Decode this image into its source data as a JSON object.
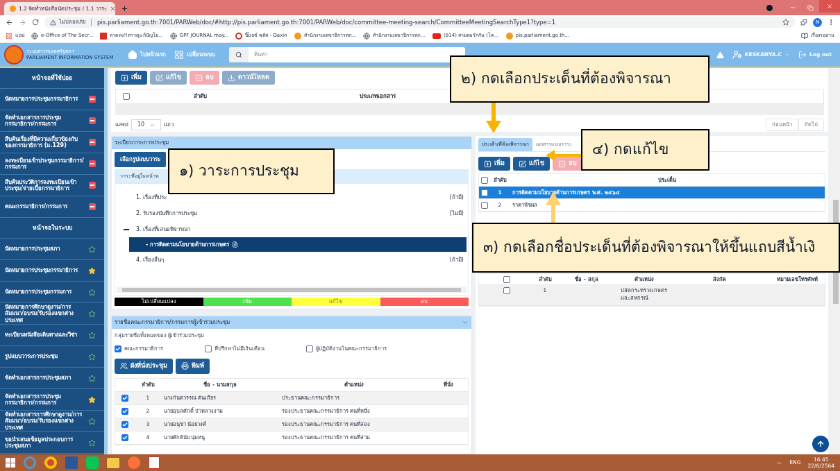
{
  "browser": {
    "tab_title": "1.2 จัดทำหนังสือนัดประชุม / 1.1 วาระ",
    "security_label": "ไม่ปลอดภัย",
    "url": "pis.parliament.go.th:7001/PARWeb/doc/#http://pis.parliament.go.th:7001/PARWeb/doc/committee-meeting-search/CommitteeMeetingSearchType1?type=1",
    "profile_initial": "N",
    "reading_list": "เรื่องรออ่าน",
    "bookmarks": [
      "แอป",
      "e-Office of The Secr...",
      "ลาดลง!!สาวดูแก้ปัญโย...",
      "GPF JOURNAL may...",
      "บิ๊มอซ์ พลัส - Daxin",
      "สำนักงานเลขาธิการสภ...",
      "สำนักงานเลขาธิการสภ...",
      "(814) สายลมรักกัน (โค...",
      "pis.parliament.go.th..."
    ]
  },
  "header": {
    "org_name": "ระบบสารสนเทศรัฐสภา",
    "org_subtitle": "PARLIAMENT INFORMATION SYSTEM",
    "home": "ไปหน้าแรก",
    "switch": "เปลี่ยนระบบ",
    "search_placeholder": "ค้นหา",
    "user": "KESKANYA.C",
    "logout": "Log out"
  },
  "sidebar": {
    "sections": [
      {
        "title": "หน้าจอที่ใช้บ่อย",
        "items": [
          {
            "label": "นัดหมายการประชุมกรรมาธิการ",
            "kind": "remove"
          },
          {
            "label": "จัดทำเอกสารการประชุมกรรมาธิการ/กรรมการ",
            "kind": "remove"
          },
          {
            "label": "สืบค้นเรื่องที่มีความเกี่ยวข้องกับของกรรมาธิการ (ม.129)",
            "kind": "remove"
          },
          {
            "label": "ลงทะเบียนเข้าประชุมกรรมาธิการ/กรรมการ",
            "kind": "remove"
          },
          {
            "label": "สืบค้นประวัติการลงทะเบียนเข้าประชุม/จ่ายเบี้ยกรรมาธิการ",
            "kind": "remove"
          },
          {
            "label": "คณะกรรมาธิการ/กรรมการ",
            "kind": "remove"
          }
        ]
      },
      {
        "title": "หน้าจอในระบบ",
        "items": [
          {
            "label": "นัดหมายการประชุมสภา",
            "kind": "favorite",
            "starred": false
          },
          {
            "label": "นัดหมายการประชุมกรรมาธิการ",
            "kind": "favorite",
            "starred": true
          },
          {
            "label": "นัดหมายการประชุมกรรมการ",
            "kind": "favorite",
            "starred": false
          },
          {
            "label": "นัดหมายการศึกษาดูงาน/การสัมมนา/อบรม/รับรองแขกต่างประเทศ",
            "kind": "favorite",
            "starred": false
          },
          {
            "label": "ทะเบียนหนังสือเดินทางและวีซ่า",
            "kind": "favorite",
            "starred": false
          },
          {
            "label": "รูปแบบวาระการประชุม",
            "kind": "favorite",
            "starred": false
          },
          {
            "label": "จัดทำเอกสารการประชุมสภา",
            "kind": "favorite",
            "starred": false
          },
          {
            "label": "จัดทำเอกสารการประชุมกรรมาธิการ/กรรมการ",
            "kind": "favorite",
            "starred": true
          },
          {
            "label": "จัดทำเอกสารการศึกษาดูงาน/การสัมมนา/อบรม/รับรองแขกต่างประเทศ",
            "kind": "favorite",
            "starred": false
          },
          {
            "label": "ขอนำเสนอข้อมูลประกอบการประชุมสภา",
            "kind": "favorite",
            "starred": false
          }
        ]
      }
    ]
  },
  "documents": {
    "buttons": [
      {
        "label": "เพิ่ม",
        "kind": "add",
        "disabled": false
      },
      {
        "label": "แก้ไข",
        "kind": "edit",
        "disabled": true
      },
      {
        "label": "ลบ",
        "kind": "delete",
        "disabled": true
      },
      {
        "label": "ดาวน์โหลด",
        "kind": "download",
        "disabled": true
      }
    ],
    "all_checked": false,
    "columns": [
      "ลำดับ",
      "ประเภทเอกสาร"
    ],
    "show_label": "แสดง",
    "page_size": "10",
    "rows_label": "แถว",
    "pager": [
      "ก่อนหน้า",
      "ถัดไป"
    ]
  },
  "agenda": {
    "title": "ระเบียบวาระการประชุม",
    "format_button": "เลือกรูปแบบวาระ",
    "tab": "วาระที่อยู่ในหน้าห",
    "items": [
      {
        "label": "1. เรื่องที่ประ",
        "note": "(ถ้ามี)"
      },
      {
        "label": "2. รับรองบันทึกการประชุม",
        "note": "(ไม่มี)"
      },
      {
        "label": "3. เรื่องที่เสนอพิจารณา",
        "expanded": true,
        "children": [
          {
            "label": "- การติดตามนโยบายด้านการเกษตร",
            "selected": true
          }
        ]
      },
      {
        "label": "4. เรื่องอื่นๆ",
        "note": "(ถ้ามี)"
      }
    ],
    "legend": [
      {
        "label": "ไม่เปลี่ยนแปลง",
        "color": "#000000"
      },
      {
        "label": "เพิ่ม",
        "color": "#4ee34e"
      },
      {
        "label": "แก้ไข",
        "color": "#ffff3c"
      },
      {
        "label": "ลบ",
        "color": "#ff5a5a"
      }
    ]
  },
  "attendees": {
    "title": "รายชื่อคณะกรรมาธิการ/กรรมการผู้เข้าร่วมประชุม",
    "subtitle": "กลุ่มรายชื่อทั้งหมดของ ผู้เข้าร่วมประชุม",
    "groups": [
      {
        "label": "คณะกรรมาธิการ",
        "checked": true
      },
      {
        "label": "ที่ปรึกษาไม่มีเงินเดือน",
        "checked": false
      },
      {
        "label": "ผู้ปฏิบัติงานในคณะกรรมาธิการ",
        "checked": false
      }
    ],
    "buttons": [
      {
        "label": "ผังที่นั่งประชุม",
        "kind": "seating"
      },
      {
        "label": "พิมพ์",
        "kind": "print"
      }
    ],
    "columns": [
      "ลำดับ",
      "ชื่อ - นามสกุล",
      "ตำแหน่ง",
      "ที่นั่ง"
    ],
    "rows": [
      {
        "number": "1",
        "name": "นางกันตวรรณ ตันเถียร",
        "position": "ประธานคณะกรรมาธิการ",
        "checked": true
      },
      {
        "number": "2",
        "name": "นายอุบลศักดิ์ บัวหลวงงาม",
        "position": "รองประธานคณะกรรมาธิการ คนที่หนึ่ง",
        "checked": true
      },
      {
        "number": "3",
        "name": "นายอนุชา น้อยวงศ์",
        "position": "รองประธานคณะกรรมาธิการ คนที่สอง",
        "checked": true
      },
      {
        "number": "4",
        "name": "นายศักดินัย นุ่มหนู",
        "position": "รองประธานคณะกรรมาธิการ คนที่สาม",
        "checked": true
      }
    ]
  },
  "issues": {
    "tabs": [
      {
        "label": "ประเด็นที่ต้องพิจารณา",
        "selected": true
      },
      {
        "label": "เอกสารแนบวาระ",
        "selected": false
      }
    ],
    "buttons": [
      {
        "label": "เพิ่ม",
        "kind": "add",
        "disabled": false
      },
      {
        "label": "แก้ไข",
        "kind": "edit",
        "disabled": false
      },
      {
        "label": "ลบ",
        "kind": "delete",
        "disabled": true
      }
    ],
    "all_checked": false,
    "columns": [
      "ลำดับ",
      "ประเด็น"
    ],
    "rows": [
      {
        "number": "1",
        "title": "การติดตามนโยบายด้านการเกษตร พ.ศ. ๒๕๖๔",
        "selected": true,
        "checked": false
      },
      {
        "number": "2",
        "title": "ราคาพืชผล",
        "selected": false,
        "checked": false
      }
    ],
    "participants_all_checked": false,
    "participant_columns": [
      "ลำดับ",
      "ชื่อ - สกุล",
      "ตำแหน่ง",
      "สังกัด",
      "หมายเลขโทรศัพท์"
    ],
    "participants": [
      {
        "number": "1",
        "position": "ปลัดกระทรวงเกษตรและสหกรณ์",
        "checked": false
      }
    ]
  },
  "annotations": [
    {
      "text": "๒) กดเลือกประเด็นที่ต้องพิจารณา",
      "kind": "down"
    },
    {
      "text": "๔) กดแก้ไข",
      "kind": "left"
    },
    {
      "text": "๑) วาระการประชุม",
      "kind": "plain"
    },
    {
      "text": "๓) กดเลือกชื่อประเด็นที่ต้องพิจารณาให้ขึ้นแถบสีน้ำเงิ",
      "kind": "up"
    }
  ],
  "taskbar": {
    "language": "ENG",
    "time": "16:45",
    "date": "22/6/2564"
  }
}
